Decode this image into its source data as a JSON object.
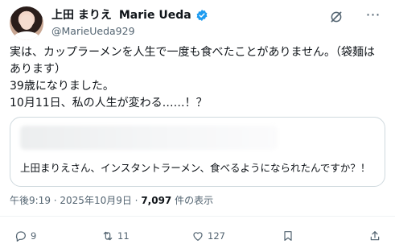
{
  "author": {
    "display_name_ja": "上田 まりえ",
    "display_name_en": "Marie Ueda",
    "handle": "@MarieUeda929",
    "verified_icon": "verified-badge-icon"
  },
  "tweet": {
    "lines": [
      "実は、カップラーメンを人生で一度も食べたことがありません。（袋麺は",
      "あります）",
      "39歳になりました。",
      "10月11日、私の人生が変わる……！？"
    ]
  },
  "card": {
    "text": "上田まりえさん、インスタントラーメン、食べるようになられたんですか？！"
  },
  "meta": {
    "time": "午後9:19",
    "separator": " · ",
    "date": "2025年10月9日",
    "views_count": "7,097",
    "views_label": " 件の表示"
  },
  "actions": {
    "reply_count": "9",
    "repost_count": "11",
    "like_count": "127"
  },
  "colors": {
    "accent": "#1d9bf0",
    "muted": "#536471",
    "text": "#0f1419",
    "border": "#cfd9de"
  }
}
